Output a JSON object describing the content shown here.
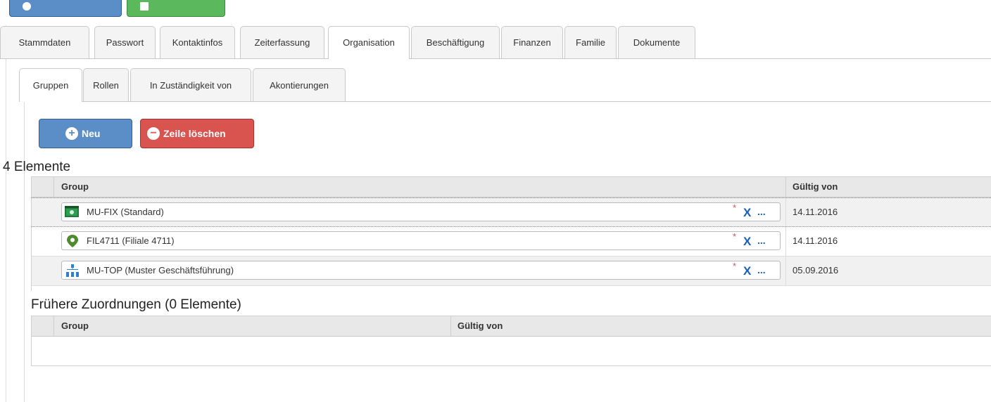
{
  "tabs_main": [
    "Stammdaten",
    "Passwort",
    "Kontaktinfos",
    "Zeiterfassung",
    "Organisation",
    "Beschäftigung",
    "Finanzen",
    "Familie",
    "Dokumente"
  ],
  "tabs_main_active": "Organisation",
  "tabs_sub": [
    "Gruppen",
    "Rollen",
    "In Zuständigkeit von",
    "Akontierungen"
  ],
  "tabs_sub_active": "Gruppen",
  "actions": {
    "new_label": "Neu",
    "delete_label": "Zeile löschen"
  },
  "current": {
    "heading": "4 Elemente",
    "columns": {
      "group": "Group",
      "valid_from": "Gültig von"
    },
    "rows": [
      {
        "icon": "money-icon",
        "group": "MU-FIX (Standard)",
        "valid_from": "14.11.2016"
      },
      {
        "icon": "location-pin-icon",
        "group": "FIL4711 (Filiale 4711)",
        "valid_from": "14.11.2016"
      },
      {
        "icon": "org-chart-icon",
        "group": "MU-TOP (Muster Geschäftsführung)",
        "valid_from": "05.09.2016"
      }
    ],
    "required_mark": "*",
    "clear_label": "X",
    "more_label": "..."
  },
  "previous": {
    "heading": "Frühere Zuordnungen (0 Elemente)",
    "columns": {
      "group": "Group",
      "valid_from": "Gültig von"
    }
  },
  "colors": {
    "primary": "#5b8ec7",
    "danger": "#d9534f",
    "success": "#5cb85c",
    "link": "#1a5fb4"
  }
}
